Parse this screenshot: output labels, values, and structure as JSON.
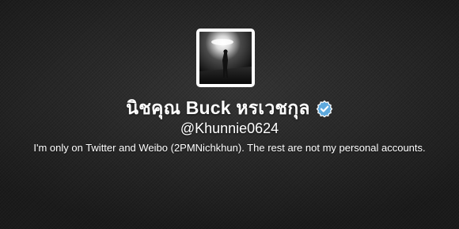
{
  "profile": {
    "full_name": "นิชคุณ Buck หรเวชกุล",
    "screen_name": "@Khunnie0624",
    "bio": "I'm only on Twitter and Weibo (2PMNichkhun). The rest are not my personal accounts.",
    "verified": true,
    "avatar_icon": "avatar-photo",
    "verified_icon": "verified-badge-icon"
  },
  "colors": {
    "background": "#2a2a2a",
    "text": "#ffffff",
    "verified_badge": "#5ea9dd"
  }
}
